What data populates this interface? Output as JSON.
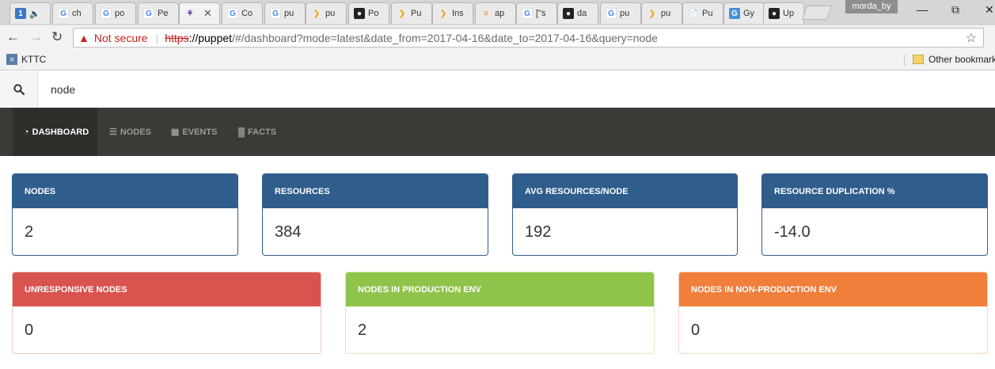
{
  "browser": {
    "tabs": [
      {
        "icon": "number-badge-icon",
        "label": "1",
        "x": 0
      },
      {
        "icon": "google-icon",
        "label": "ch"
      },
      {
        "icon": "google-icon",
        "label": "po"
      },
      {
        "icon": "google-icon",
        "label": "Pe"
      },
      {
        "icon": "puppetboard-icon",
        "label": "",
        "active": true
      },
      {
        "icon": "google-icon",
        "label": "Co"
      },
      {
        "icon": "google-icon",
        "label": "pu"
      },
      {
        "icon": "puppet-icon",
        "label": "pu"
      },
      {
        "icon": "github-icon",
        "label": "Po"
      },
      {
        "icon": "puppet-icon",
        "label": "Pu"
      },
      {
        "icon": "puppet-icon",
        "label": "Ins"
      },
      {
        "icon": "stackoverflow-icon",
        "label": "ap"
      },
      {
        "icon": "google-icon",
        "label": "[\"s"
      },
      {
        "icon": "github-icon",
        "label": "da"
      },
      {
        "icon": "google-icon",
        "label": "pu"
      },
      {
        "icon": "puppet-icon",
        "label": "pu"
      },
      {
        "icon": "document-icon",
        "label": "Pu"
      },
      {
        "icon": "gy-icon",
        "label": "Gy"
      },
      {
        "icon": "github-icon",
        "label": "Up"
      }
    ],
    "profile_name": "morda_by",
    "address": {
      "security_label": "Not secure",
      "scheme": "https",
      "host": "://puppet",
      "path": "/#/dashboard?mode=latest&date_from=2017-04-16&date_to=2017-04-16&query=node"
    },
    "bookmarks": {
      "first": "KTTC",
      "other": "Other bookmarks"
    }
  },
  "search": {
    "value": "node"
  },
  "nav": {
    "dashboard": "DASHBOARD",
    "nodes": "NODES",
    "events": "EVENTS",
    "facts": "FACTS"
  },
  "stats_row1": [
    {
      "title": "NODES",
      "value": "2",
      "color": "#2f5d8c"
    },
    {
      "title": "RESOURCES",
      "value": "384",
      "color": "#2f5d8c"
    },
    {
      "title": "AVG RESOURCES/NODE",
      "value": "192",
      "color": "#2f5d8c"
    },
    {
      "title": "RESOURCE DUPLICATION %",
      "value": "-14.0",
      "color": "#2f5d8c"
    }
  ],
  "stats_row2": [
    {
      "title": "UNRESPONSIVE NODES",
      "value": "0",
      "color": "#d9534f"
    },
    {
      "title": "NODES IN PRODUCTION ENV",
      "value": "2",
      "color": "#8fc34a"
    },
    {
      "title": "NODES IN NON-PRODUCTION ENV",
      "value": "0",
      "color": "#f07f3c"
    }
  ]
}
